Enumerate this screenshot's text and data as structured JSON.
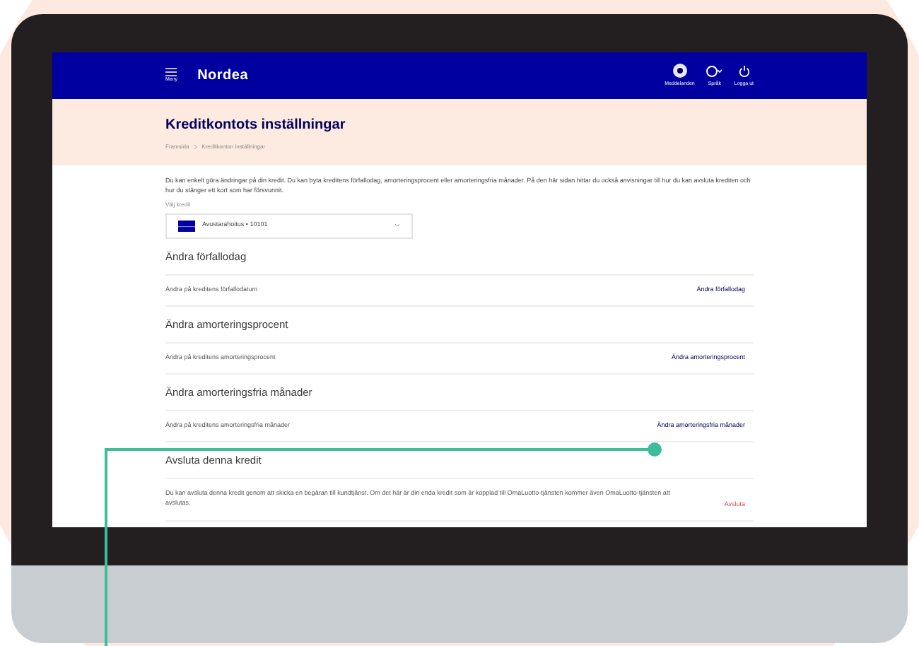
{
  "header": {
    "menu_label": "Meny",
    "logo": "Nordea",
    "actions": [
      {
        "kind": "messages",
        "label": "Meddelanden"
      },
      {
        "kind": "language",
        "label": "Språk"
      },
      {
        "kind": "logout",
        "label": "Logga ut"
      }
    ]
  },
  "page_title": "Kreditkontots inställningar",
  "breadcrumb": [
    "Framsida",
    "Kreditkonton inställningar"
  ],
  "intro": "Du kan enkelt göra ändringar på din kredit. Du kan byta kreditens förfallodag, amorteringsprocent eller amorteringsfria månader. På den här sidan hittar du också anvisningar till hur du kan avsluta krediten och hur du stänger ett kort som har försvunnit.",
  "select": {
    "label": "Välj kredit",
    "value": "Avustarahoitus • 10101"
  },
  "sections": [
    {
      "kind": "link",
      "heading": "Ändra förfallodag",
      "description": "Ändra på kreditens förfallodatum",
      "action": "Ändra förfallodag"
    },
    {
      "kind": "link",
      "heading": "Ändra amorteringsprocent",
      "description": "Ändra på kreditens amorteringsprocent",
      "action": "Ändra amorteringsprocent"
    },
    {
      "kind": "link",
      "heading": "Ändra amorteringsfria månader",
      "description": "Ändra på kreditens amorteringsfria månader",
      "action": "Ändra amorteringsfria månader"
    },
    {
      "kind": "danger",
      "heading": "Avsluta denna kredit",
      "description": "Du kan avsluta denna kredit genom att skicka en begäran till kundtjänst. Om det här är din enda kredit som är kopplad till OmaLuotto-tjänsten kommer även OmaLuotto-tjänsten att avslutas.",
      "action": "Avsluta"
    }
  ]
}
